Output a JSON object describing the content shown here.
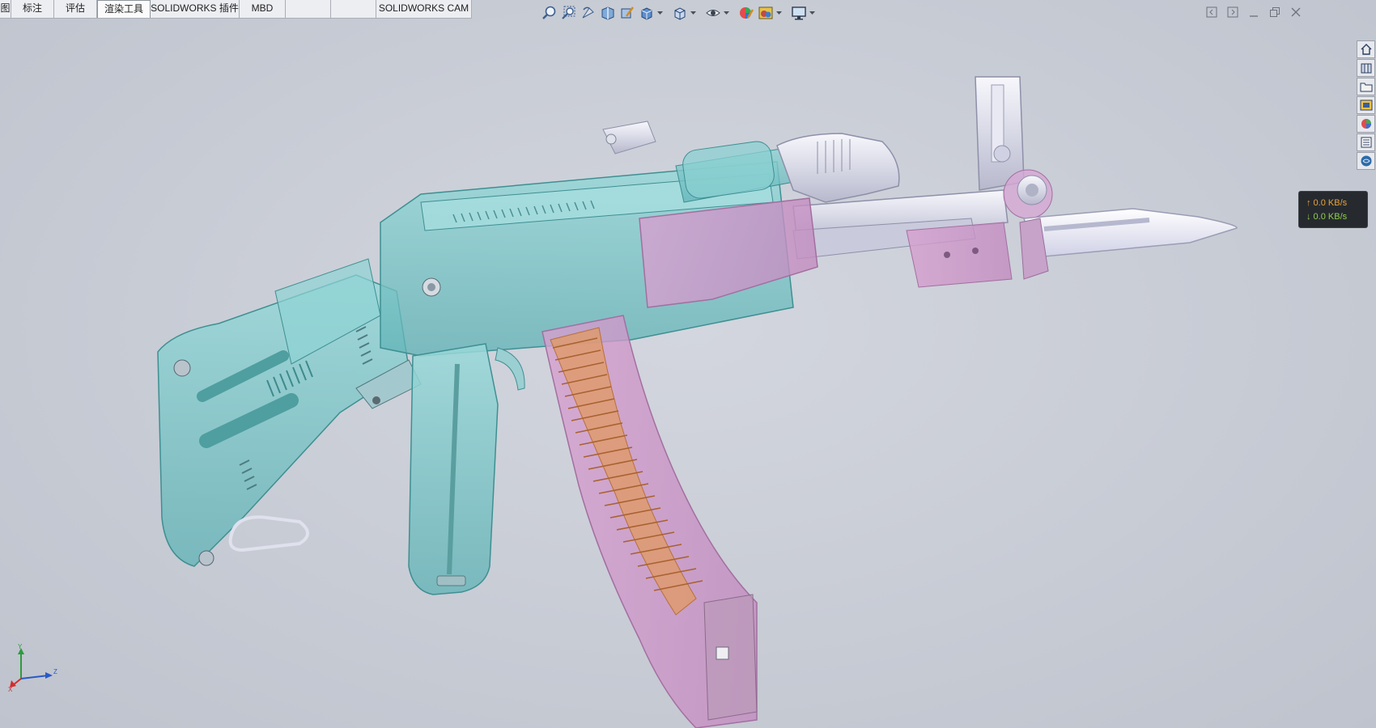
{
  "command_manager": {
    "tabs": [
      {
        "label": "图"
      },
      {
        "label": "标注"
      },
      {
        "label": "评估"
      },
      {
        "label": "渲染工具",
        "active": true
      },
      {
        "label": "SOLIDWORKS 插件"
      },
      {
        "label": "MBD"
      },
      {
        "label": ""
      },
      {
        "label": ""
      },
      {
        "label": "SOLIDWORKS CAM"
      }
    ]
  },
  "heads_up_toolbar": {
    "icons": [
      "zoom-to-fit-icon",
      "zoom-to-area-icon",
      "previous-view-icon",
      "section-view-icon",
      "dynamic-annotation-icon",
      "view-orientation-icon",
      "display-style-icon",
      "hide-show-items-icon",
      "edit-appearance-icon",
      "apply-scene-icon",
      "view-settings-icon"
    ]
  },
  "task_pane": {
    "icons": [
      "home-icon",
      "design-library-icon",
      "file-explorer-icon",
      "view-palette-icon",
      "appearances-icon",
      "custom-properties-icon",
      "solidworks-forum-icon"
    ]
  },
  "net_speed": {
    "upload": "↑ 0.0 KB/s",
    "download": "↓ 0.0 KB/s"
  },
  "triad": {
    "x": "X",
    "y": "Y",
    "z": "Z"
  },
  "colors": {
    "background": "#c8ccd5",
    "stock_teal": "#7cc7c9",
    "magazine_orange": "#e0935a",
    "magazine_pink": "#d9a4d2",
    "metal": "#e3e4ee"
  }
}
